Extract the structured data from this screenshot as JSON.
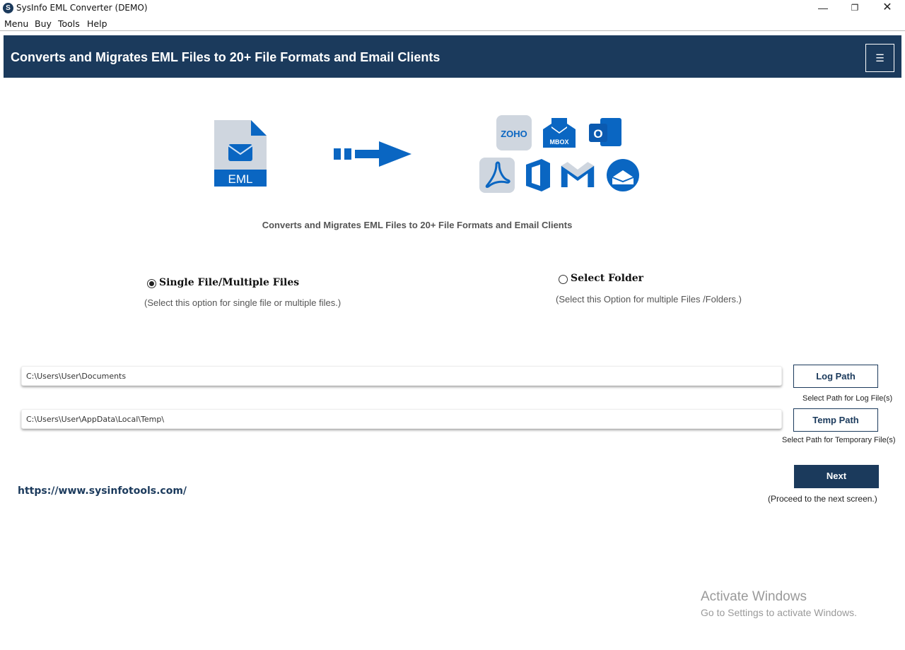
{
  "window": {
    "title": "SysInfo EML Converter (DEMO)",
    "app_icon_letter": "S",
    "controls": {
      "minimize": "—",
      "maximize": "❐",
      "close": "✕"
    }
  },
  "menu": [
    "Menu",
    "Buy",
    "Tools",
    "Help"
  ],
  "header": {
    "title": "Converts and Migrates EML Files to 20+ File Formats and Email Clients",
    "menu_icon": "☰"
  },
  "hero": {
    "source_label": "EML",
    "target_icons": [
      "zoho-icon",
      "mbox-icon",
      "outlook-icon",
      "pdf-icon",
      "office365-icon",
      "gmail-icon",
      "thunderbird-icon"
    ],
    "mbox_label": "MBOX",
    "zoho_label": "ZOHO",
    "outlook_letter": "O",
    "subtitle": "Converts and Migrates EML Files to 20+ File Formats and Email Clients"
  },
  "options": {
    "single": {
      "label": "Single File/Multiple Files",
      "description": "(Select this option for single file or multiple files.)",
      "checked": true
    },
    "folder": {
      "label": "Select Folder",
      "description": "(Select this Option for multiple Files /Folders.)",
      "checked": false
    }
  },
  "paths": {
    "log": {
      "value": "C:\\Users\\User\\Documents",
      "button": "Log Path",
      "hint": "Select Path for Log File(s)"
    },
    "temp": {
      "value": "C:\\Users\\User\\AppData\\Local\\Temp\\",
      "button": "Temp Path",
      "hint": "Select Path for Temporary File(s)"
    }
  },
  "footer": {
    "website": "https://www.sysinfotools.com/",
    "next_button": "Next",
    "next_hint": "(Proceed to the next screen.)"
  },
  "watermark": {
    "title": "Activate Windows",
    "subtitle": "Go to Settings to activate Windows."
  },
  "colors": {
    "brand": "#1b3a5c",
    "accent_blue": "#0a66c2"
  }
}
